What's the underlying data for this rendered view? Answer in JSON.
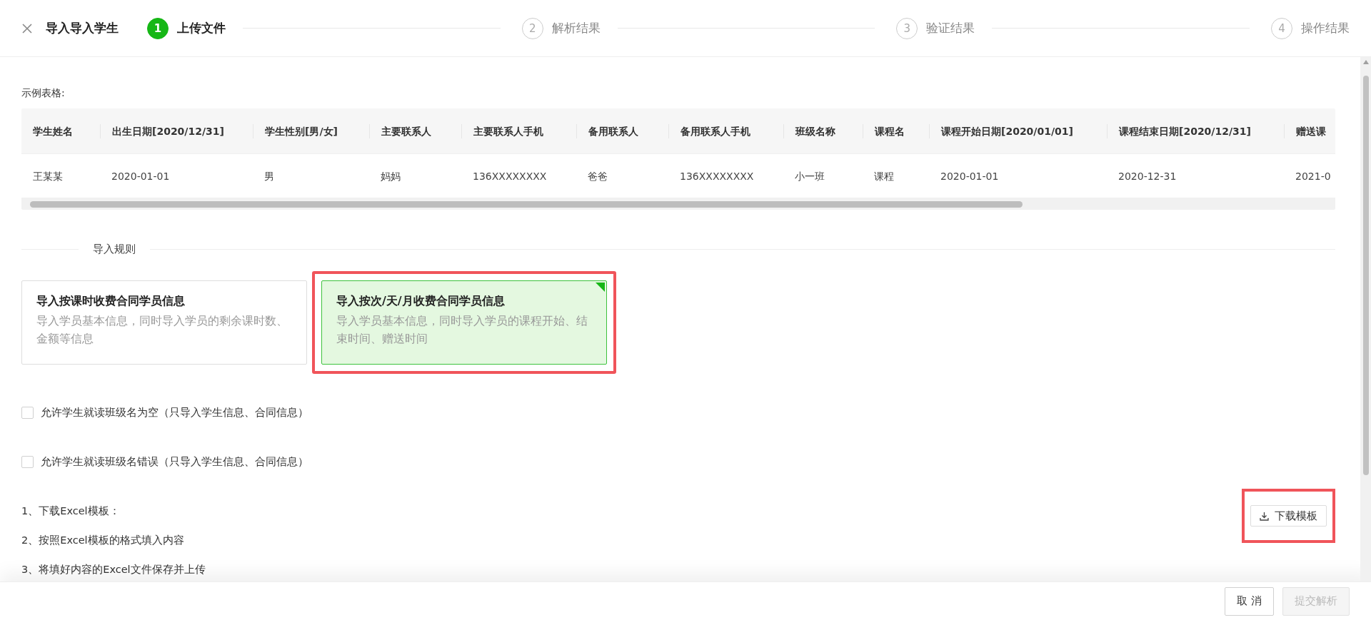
{
  "header": {
    "title": "导入导入学生",
    "steps": [
      {
        "number": "1",
        "label": "上传文件",
        "selected": true
      },
      {
        "number": "2",
        "label": "解析结果",
        "selected": false
      },
      {
        "number": "3",
        "label": "验证结果",
        "selected": false
      },
      {
        "number": "4",
        "label": "操作结果",
        "selected": false
      }
    ]
  },
  "example": {
    "label": "示例表格:",
    "table": {
      "columns": [
        "学生姓名",
        "出生日期[2020/12/31]",
        "学生性别[男/女]",
        "主要联系人",
        "主要联系人手机",
        "备用联系人",
        "备用联系人手机",
        "班级名称",
        "课程名",
        "课程开始日期[2020/01/01]",
        "课程结束日期[2020/12/31]",
        "赠送课"
      ],
      "rows": [
        [
          "王某某",
          "2020-01-01",
          "男",
          "妈妈",
          "136XXXXXXXX",
          "爸爸",
          "136XXXXXXXX",
          "小一班",
          "课程",
          "2020-01-01",
          "2020-12-31",
          "2021-0"
        ]
      ]
    }
  },
  "rules": {
    "title": "导入规则",
    "options": [
      {
        "title": "导入按课时收费合同学员信息",
        "description": "导入学员基本信息，同时导入学员的剩余课时数、金额等信息",
        "selected": false,
        "highlighted": false
      },
      {
        "title": "导入按次/天/月收费合同学员信息",
        "description": "导入学员基本信息，同时导入学员的课程开始、结束时间、赠送时间",
        "selected": true,
        "highlighted": true
      }
    ]
  },
  "checkboxes": [
    {
      "label": "允许学生就读班级名为空（只导入学生信息、合同信息）",
      "checked": false
    },
    {
      "label": "允许学生就读班级名错误（只导入学生信息、合同信息）",
      "checked": false
    }
  ],
  "instructions": [
    "1、下载Excel模板：",
    "2、按照Excel模板的格式填入内容",
    "3、将填好内容的Excel文件保存并上传"
  ],
  "download_button": {
    "label": "下载模板",
    "highlighted": true
  },
  "footer": {
    "buttons": [
      {
        "label": "取 消",
        "disabled": false
      },
      {
        "label": "提交解析",
        "disabled": true
      }
    ]
  }
}
